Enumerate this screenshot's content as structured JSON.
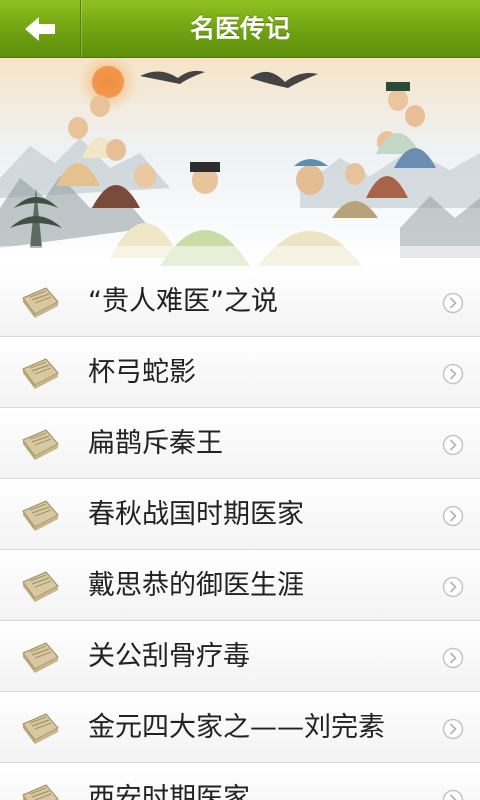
{
  "header": {
    "title": "名医传记",
    "back_icon": "arrow-left-icon"
  },
  "banner": {
    "description_icon": "ancient-physicians-illustration"
  },
  "list": {
    "item_icon": "book-icon",
    "chevron_icon": "chevron-right-circle-icon",
    "items": [
      {
        "label": "“贵人难医”之说"
      },
      {
        "label": "杯弓蛇影"
      },
      {
        "label": "扁鹊斥秦王"
      },
      {
        "label": "春秋战国时期医家"
      },
      {
        "label": "戴思恭的御医生涯"
      },
      {
        "label": "关公刮骨疗毒"
      },
      {
        "label": "金元四大家之——刘完素"
      },
      {
        "label": "西安时期医家"
      }
    ]
  },
  "colors": {
    "header_green": "#6fa112",
    "text": "#222222",
    "divider": "#d9d9d9"
  }
}
